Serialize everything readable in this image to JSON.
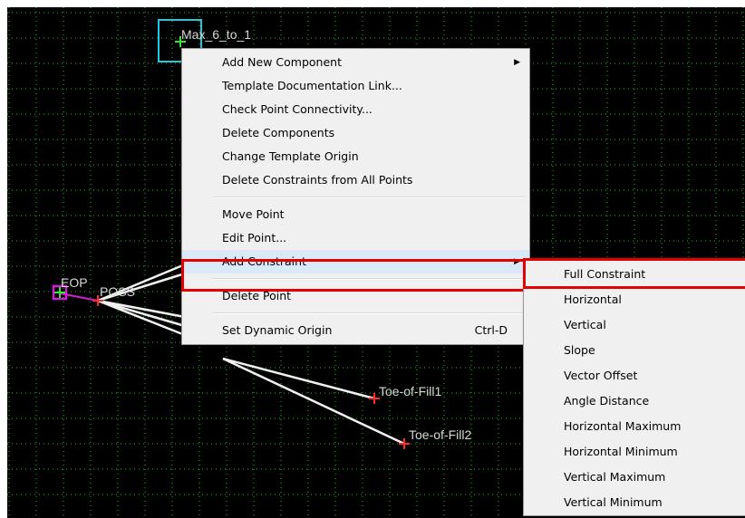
{
  "canvas": {
    "background": "#000000",
    "grid_color": "#1fbf1f",
    "labels": {
      "max_6_to_1": "Max_6_to_1",
      "eop": "EOP",
      "poss": "POSS",
      "toe_of_fill1": "Toe-of-Fill1",
      "toe_of_fill2": "Toe-of-Fill2"
    }
  },
  "context_menu": {
    "items": [
      {
        "label": "Add New Component",
        "submenu": true
      },
      {
        "label": "Template Documentation Link..."
      },
      {
        "label": "Check Point Connectivity..."
      },
      {
        "label": "Delete Components"
      },
      {
        "label": "Change Template Origin"
      },
      {
        "label": "Delete Constraints from All Points"
      },
      {
        "label": "Move Point"
      },
      {
        "label": "Edit Point..."
      },
      {
        "label": "Add Constraint",
        "submenu": true,
        "highlighted": true
      },
      {
        "label": "Delete Point"
      },
      {
        "label": "Set Dynamic Origin",
        "shortcut": "Ctrl-D"
      }
    ]
  },
  "submenu": {
    "items": [
      {
        "label": "Full Constraint",
        "highlighted": true
      },
      {
        "label": "Horizontal"
      },
      {
        "label": "Vertical"
      },
      {
        "label": "Slope"
      },
      {
        "label": "Vector Offset"
      },
      {
        "label": "Angle Distance"
      },
      {
        "label": "Horizontal Maximum"
      },
      {
        "label": "Horizontal Minimum"
      },
      {
        "label": "Vertical Maximum"
      },
      {
        "label": "Vertical Minimum"
      }
    ]
  },
  "colors": {
    "highlight_box": "#e30000",
    "selection_box": "#1ec8e0",
    "point_marker": "#ff2a2a",
    "origin_marker": "#d21ed2",
    "component_line": "#f2f2f2"
  }
}
